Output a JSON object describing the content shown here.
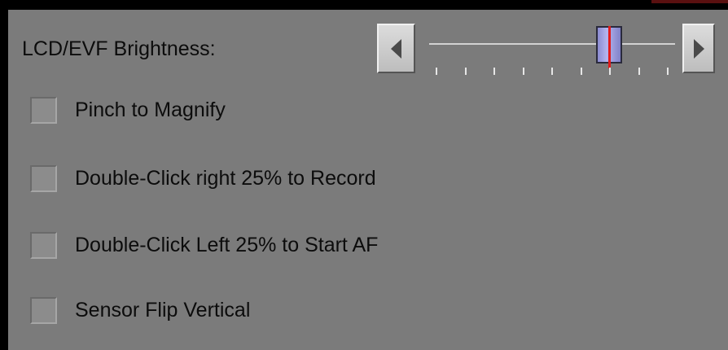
{
  "brightness": {
    "label": "LCD/EVF Brightness:",
    "level": 0.76,
    "tick_count": 9,
    "left_arrow_icon": "triangle-left-icon",
    "right_arrow_icon": "triangle-right-icon"
  },
  "options": [
    {
      "label": "Pinch to Magnify",
      "checked": false
    },
    {
      "label": "Double-Click right 25% to Record",
      "checked": false
    },
    {
      "label": "Double-Click Left 25% to Start AF",
      "checked": false
    },
    {
      "label": "Sensor Flip Vertical",
      "checked": false
    }
  ],
  "colors": {
    "panel": "#7b7b7b",
    "thumb": "#a0a0e0",
    "thumb_marker": "#e31b1b"
  }
}
